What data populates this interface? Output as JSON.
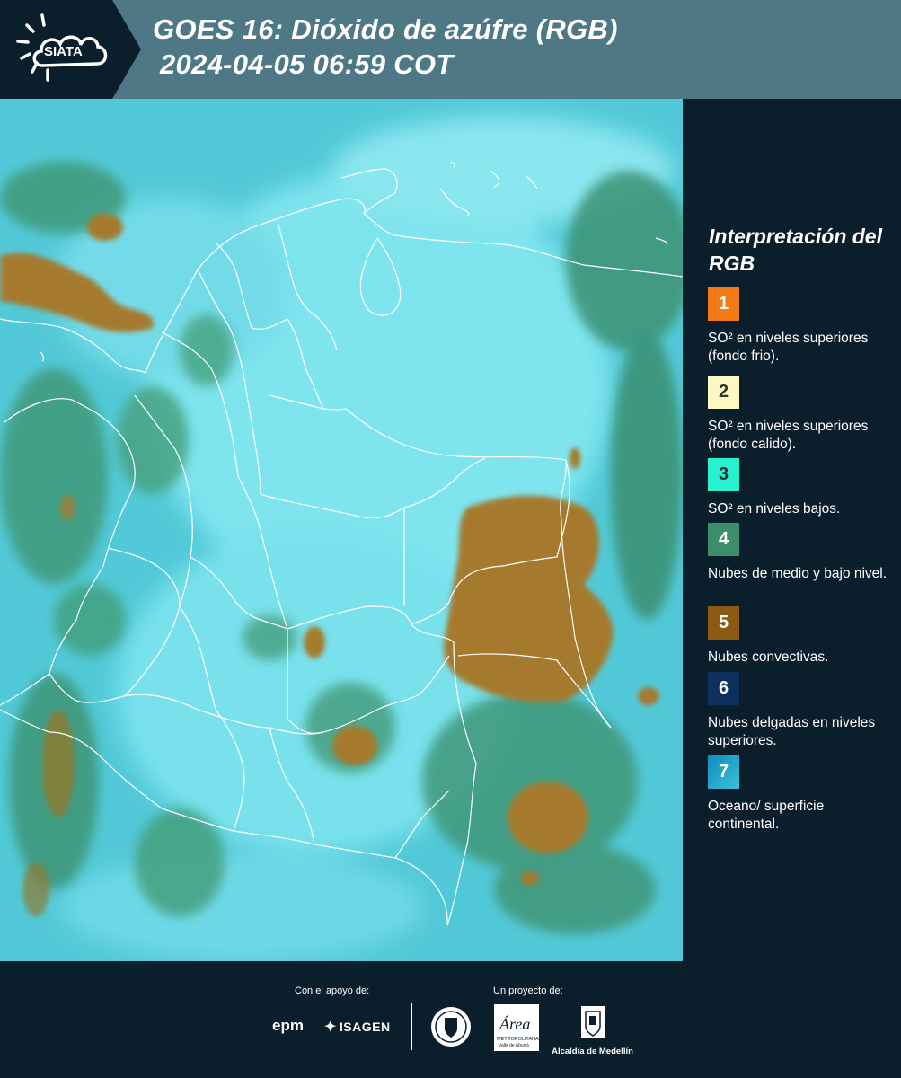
{
  "header": {
    "logo_text": "SIATA",
    "title_line1": "GOES 16: Dióxido de azúfre (RGB)",
    "title_line2": "2024-04-05 06:59 COT"
  },
  "legend": {
    "title": "Interpretación del RGB",
    "items": [
      {
        "number": "1",
        "color": "#f37a14",
        "text": "SO² en niveles superiores (fondo frio)."
      },
      {
        "number": "2",
        "color": "#fdf7c4",
        "text": "SO² en niveles superiores (fondo calido)."
      },
      {
        "number": "3",
        "color": "#27f2cf",
        "text": "SO² en niveles bajos."
      },
      {
        "number": "4",
        "color": "#3b8d6b",
        "text": "Nubes de medio y bajo nivel."
      },
      {
        "number": "5",
        "color": "#8b5b12",
        "text": "Nubes convectivas."
      },
      {
        "number": "6",
        "color": "#0f2f5f",
        "text": "Nubes delgadas en niveles superiores."
      },
      {
        "number": "7",
        "color": "#1f8ab5",
        "text": "Oceano/ superficie continental."
      }
    ]
  },
  "footer": {
    "support_label": "Con el apoyo de:",
    "project_label": "Un proyecto de:",
    "epm": "epm",
    "isagen": "ISAGEN",
    "area_sub1": "METROPOLITANA",
    "area_sub2": "Valle de Aburrá",
    "alcaldia": "Alcaldía de Medellín"
  },
  "colors": {
    "header_bg": "#4e7886",
    "logo_plate": "#0b1e2b",
    "panel_bg": "#0b1e2b",
    "map_cyan": "#4fd4e2",
    "map_green": "#3f9a78",
    "map_convective": "#a57a2e"
  }
}
